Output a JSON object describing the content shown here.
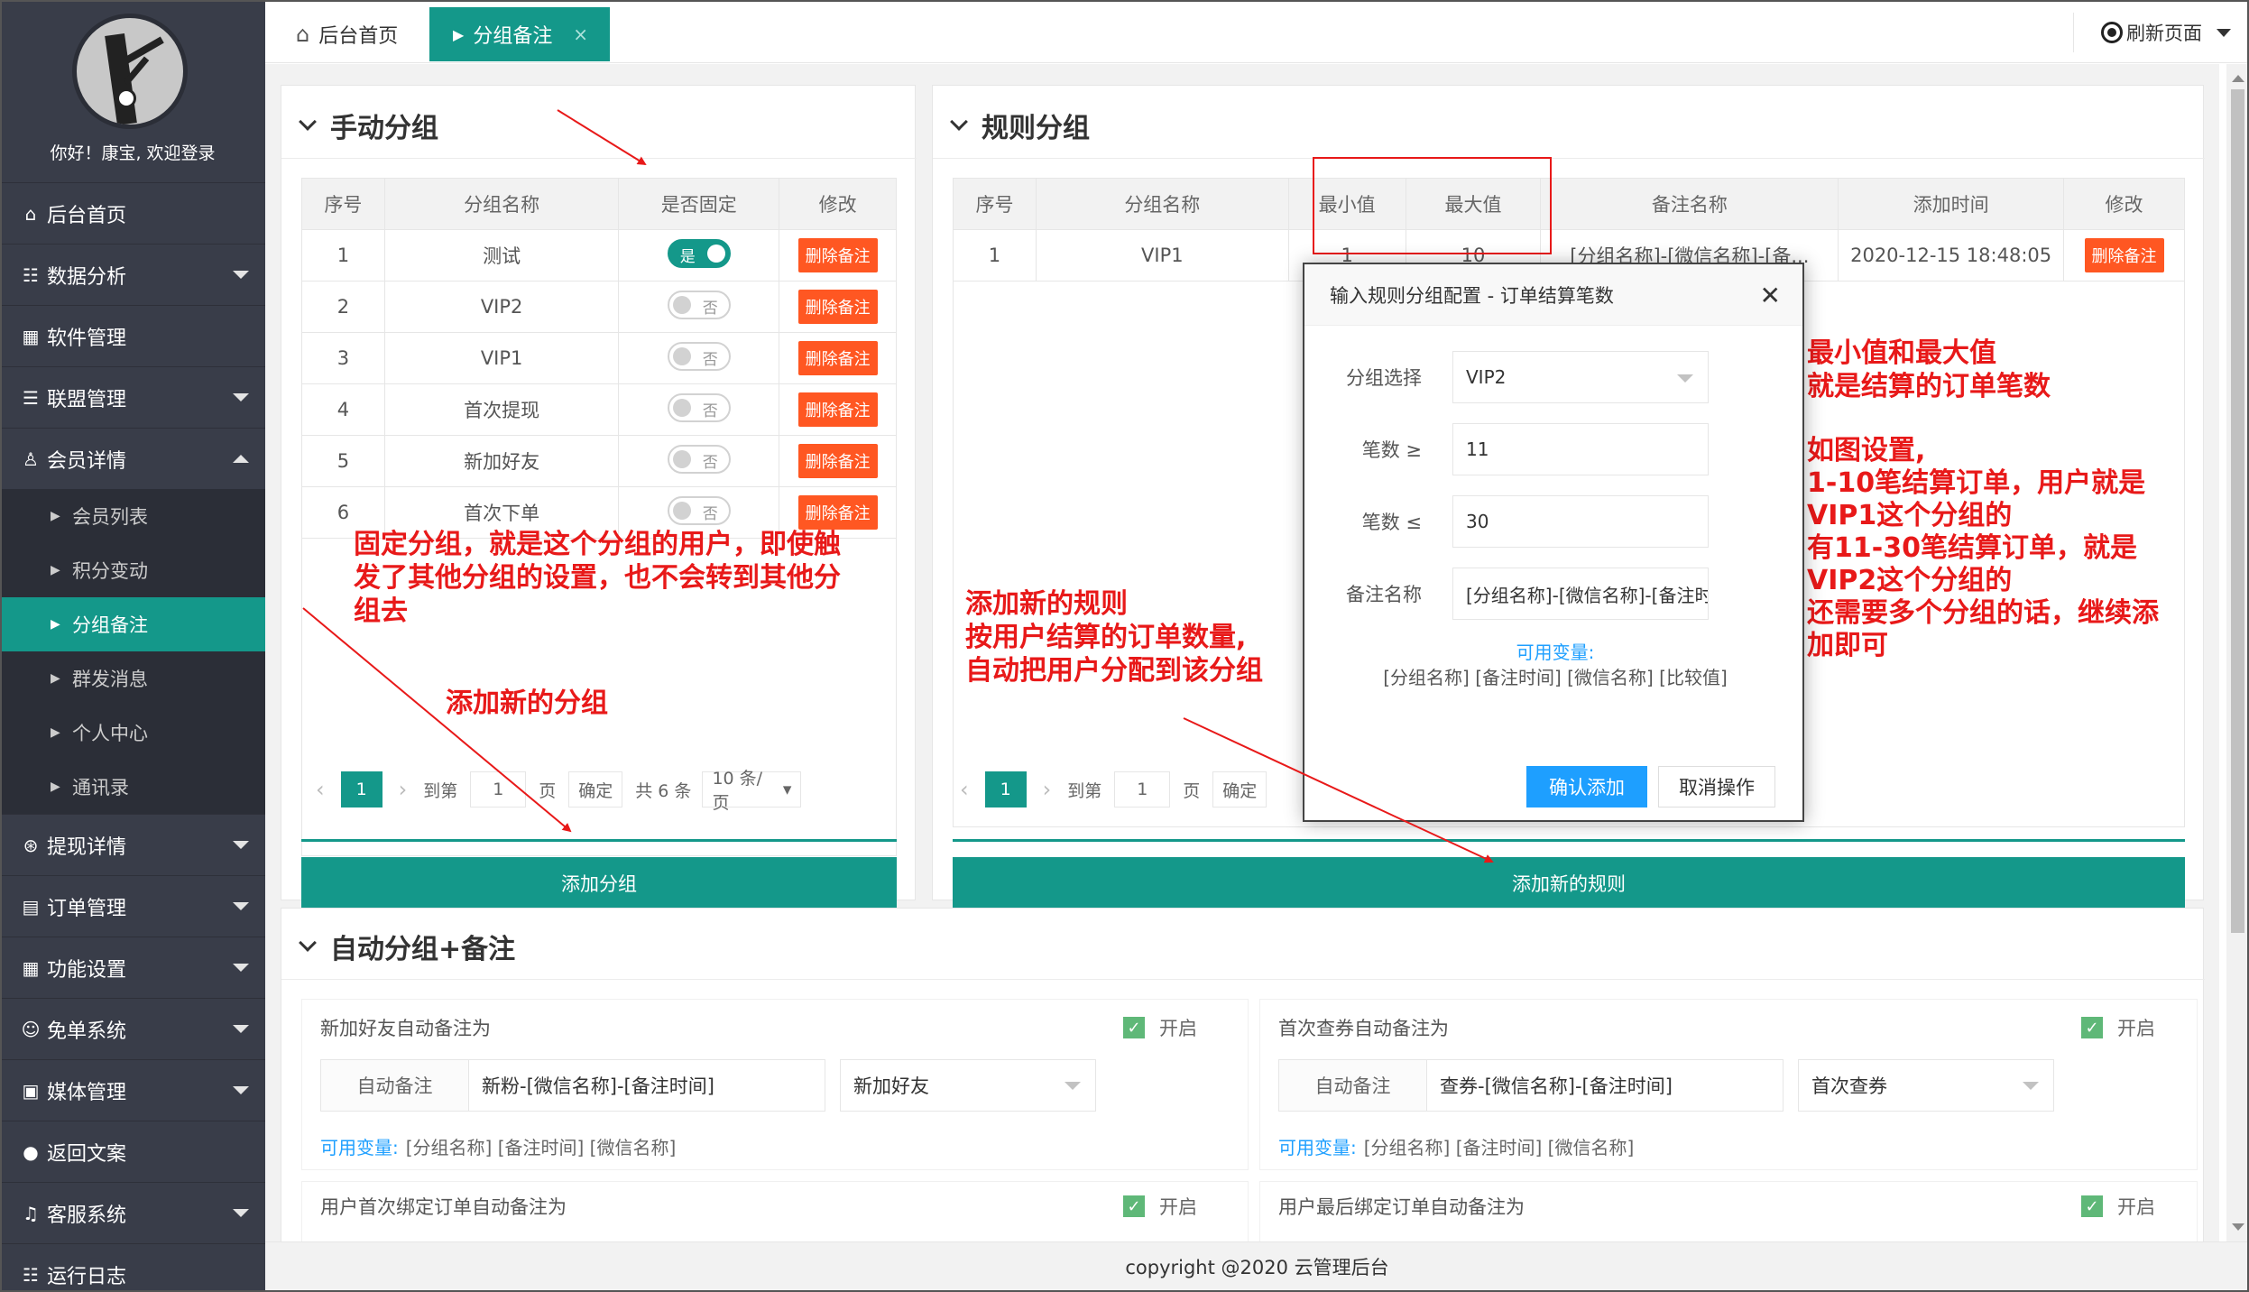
{
  "sidebar": {
    "welcome": "你好！康宝, 欢迎登录",
    "items": [
      {
        "label": "后台首页",
        "icon": "home-icon"
      },
      {
        "label": "数据分析",
        "icon": "users-icon"
      },
      {
        "label": "软件管理",
        "icon": "apps-icon"
      },
      {
        "label": "联盟管理",
        "icon": "list-icon"
      },
      {
        "label": "会员详情",
        "icon": "user-icon"
      },
      {
        "label": "会员列表"
      },
      {
        "label": "积分变动"
      },
      {
        "label": "分组备注"
      },
      {
        "label": "群发消息"
      },
      {
        "label": "个人中心"
      },
      {
        "label": "通讯录"
      },
      {
        "label": "提现详情",
        "icon": "yen-icon"
      },
      {
        "label": "订单管理",
        "icon": "grid-icon"
      },
      {
        "label": "功能设置",
        "icon": "apps-icon"
      },
      {
        "label": "免单系统",
        "icon": "gift-icon"
      },
      {
        "label": "媒体管理",
        "icon": "image-icon"
      },
      {
        "label": "返回文案",
        "icon": "chat-icon"
      },
      {
        "label": "客服系统",
        "icon": "bell-icon"
      },
      {
        "label": "运行日志",
        "icon": "users-icon"
      }
    ]
  },
  "tabs": {
    "home": "后台首页",
    "active": "分组备注",
    "close": "×",
    "refresh": "刷新页面"
  },
  "manual": {
    "title": "手动分组",
    "columns": [
      "序号",
      "分组名称",
      "是否固定",
      "修改"
    ],
    "rows": [
      {
        "no": "1",
        "name": "测试",
        "fixed": "是",
        "on": true
      },
      {
        "no": "2",
        "name": "VIP2",
        "fixed": "否",
        "on": false
      },
      {
        "no": "3",
        "name": "VIP1",
        "fixed": "否",
        "on": false
      },
      {
        "no": "4",
        "name": "首次提现",
        "fixed": "否",
        "on": false
      },
      {
        "no": "5",
        "name": "新加好友",
        "fixed": "否",
        "on": false
      },
      {
        "no": "6",
        "name": "首次下单",
        "fixed": "否",
        "on": false
      }
    ],
    "delete_label": "删除备注",
    "pager": {
      "page": "1",
      "goto": "到第",
      "goto_value": "1",
      "page_unit": "页",
      "confirm": "确定",
      "total": "共 6 条",
      "per_page": "10 条/页"
    },
    "add_button": "添加分组"
  },
  "rules": {
    "title": "规则分组",
    "columns": [
      "序号",
      "分组名称",
      "最小值",
      "最大值",
      "备注名称",
      "添加时间",
      "修改"
    ],
    "rows": [
      {
        "no": "1",
        "name": "VIP1",
        "min": "1",
        "max": "10",
        "remark": "[分组名称]-[微信名称]-[备...",
        "time": "2020-12-15 18:48:05"
      }
    ],
    "delete_label": "删除备注",
    "pager": {
      "page": "1",
      "goto": "到第",
      "goto_value": "1",
      "page_unit": "页",
      "confirm": "确定"
    },
    "add_button": "添加新的规则"
  },
  "modal": {
    "title": "输入规则分组配置 - 订单结算笔数",
    "close": "✕",
    "group_label": "分组选择",
    "group_value": "VIP2",
    "min_label": "笔数 ≥",
    "min_value": "11",
    "max_label": "笔数 ≤",
    "max_value": "30",
    "remark_label": "备注名称",
    "remark_value": "[分组名称]-[微信名称]-[备注时间]",
    "vars_label": "可用变量:",
    "vars_value": "[分组名称] [备注时间] [微信名称] [比较值]",
    "confirm": "确认添加",
    "cancel": "取消操作"
  },
  "auto": {
    "title": "自动分组+备注",
    "cards": [
      {
        "title": "新加好友自动备注为",
        "check": "开启",
        "ig_label": "自动备注",
        "ig_value": "新粉-[微信名称]-[备注时间]",
        "select": "新加好友",
        "vars_label": "可用变量:",
        "vars": "[分组名称] [备注时间] [微信名称]"
      },
      {
        "title": "首次查券自动备注为",
        "check": "开启",
        "ig_label": "自动备注",
        "ig_value": "查券-[微信名称]-[备注时间]",
        "select": "首次查券",
        "vars_label": "可用变量:",
        "vars": "[分组名称] [备注时间] [微信名称]"
      },
      {
        "title": "用户首次绑定订单自动备注为",
        "check": "开启"
      },
      {
        "title": "用户最后绑定订单自动备注为",
        "check": "开启"
      }
    ]
  },
  "annotations": {
    "fixed_note": [
      "固定分组，就是这个分组的用户，即使触",
      "发了其他分组的设置，也不会转到其他分",
      "组去"
    ],
    "add_group_note": "添加新的分组",
    "rule_note": [
      "添加新的规则",
      "按用户结算的订单数量,",
      "自动把用户分配到该分组"
    ],
    "minmax_note": [
      "最小值和最大值",
      "就是结算的订单笔数"
    ],
    "example_note": [
      "如图设置,",
      "1-10笔结算订单，用户就是",
      "VIP1这个分组的",
      "有11-30笔结算订单，就是",
      "VIP2这个分组的",
      "还需要多个分组的话，继续添",
      "加即可"
    ],
    "color": "#e81919"
  },
  "footer": "copyright @2020 云管理后台",
  "colors": {
    "sidebar": "#393d49",
    "accent": "#14988a",
    "danger": "#ff5722"
  }
}
